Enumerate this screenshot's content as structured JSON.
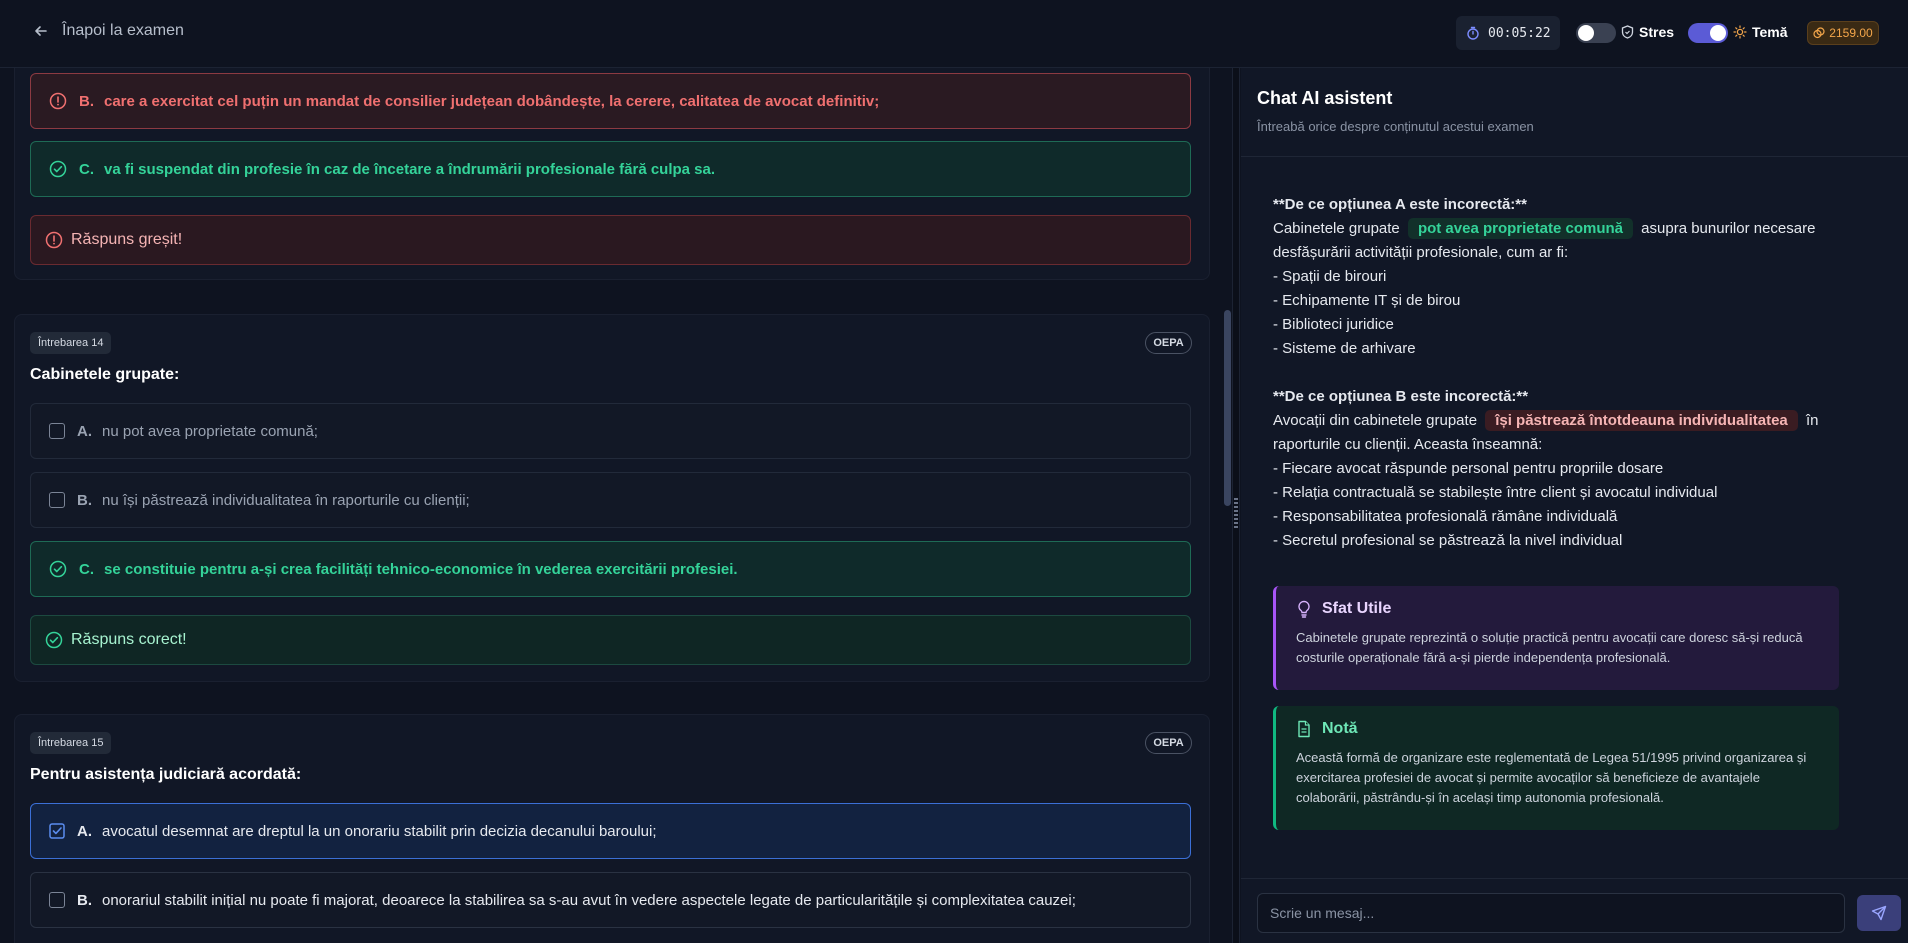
{
  "header": {
    "back_label": "Înapoi la examen",
    "timer": "00:05:22",
    "stres_label": "Stres",
    "tema_label": "Temă",
    "coins": "2159.00"
  },
  "questions": [
    {
      "options": [
        {
          "letter": "B.",
          "text": "care a exercitat cel puțin un mandat de consilier județean dobândește, la cerere, calitatea de avocat definitiv;",
          "state": "wrong"
        },
        {
          "letter": "C.",
          "text": "va fi suspendat din profesie în caz de încetare a îndrumării profesionale fără culpa sa.",
          "state": "correct"
        }
      ],
      "result": "Răspuns greșit!"
    },
    {
      "badge": "Întrebarea 14",
      "tag": "OEPA",
      "title": "Cabinetele grupate:",
      "options": [
        {
          "letter": "A.",
          "text": "nu pot avea proprietate comună;",
          "state": "neutral"
        },
        {
          "letter": "B.",
          "text": "nu își păstrează individualitatea în raporturile cu clienții;",
          "state": "neutral"
        },
        {
          "letter": "C.",
          "text": "se constituie pentru a-și crea facilități tehnico-economice în vederea exercitării profesiei.",
          "state": "correct"
        }
      ],
      "result": "Răspuns corect!"
    },
    {
      "badge": "Întrebarea 15",
      "tag": "OEPA",
      "title": "Pentru asistența judiciară acordată:",
      "options": [
        {
          "letter": "A.",
          "text": "avocatul desemnat are dreptul la un onorariu stabilit prin decizia decanului baroului;",
          "state": "selected"
        },
        {
          "letter": "B.",
          "text": "onorariul stabilit inițial nu poate fi majorat, deoarece la stabilirea sa s-au avut în vedere aspectele legate de particularitățile și complexitatea cauzei;",
          "state": "neutral2"
        }
      ]
    }
  ],
  "chat": {
    "title": "Chat AI asistent",
    "subtitle": "Întreabă orice despre conținutul acestui examen",
    "a_heading": "**De ce opțiunea A este incorectă:**",
    "a_pre": "Cabinetele grupate",
    "a_hl": "pot avea proprietate comună",
    "a_post": "asupra bunurilor necesare desfășurării activității profesionale, cum ar fi:",
    "a_list": [
      "- Spații de birouri",
      "- Echipamente IT și de birou",
      "- Biblioteci juridice",
      "- Sisteme de arhivare"
    ],
    "b_heading": "**De ce opțiunea B este incorectă:**",
    "b_pre": "Avocații din cabinetele grupate",
    "b_hl": "își păstrează întotdeauna individualitatea",
    "b_post": "în raporturile cu clienții. Aceasta înseamnă:",
    "b_list": [
      "- Fiecare avocat răspunde personal pentru propriile dosare",
      "- Relația contractuală se stabilește între client și avocatul individual",
      "- Responsabilitatea profesională rămâne individuală",
      "- Secretul profesional se păstrează la nivel individual"
    ],
    "tip_title": "Sfat Utile",
    "tip_body": "Cabinetele grupate reprezintă o soluție practică pentru avocații care doresc să-și reducă costurile operaționale fără a-și pierde independența profesională.",
    "note_title": "Notă",
    "note_body": "Această formă de organizare este reglementată de Legea 51/1995 privind organizarea și exercitarea profesiei de avocat și permite avocaților să beneficieze de avantajele colaborării, păstrându-și în același timp autonomia profesională.",
    "input_placeholder": "Scrie un mesaj..."
  },
  "colors": {
    "accent": "#5b5bd6",
    "correct": "#34d399",
    "wrong": "#f07070",
    "coins": "#f3a64b"
  }
}
